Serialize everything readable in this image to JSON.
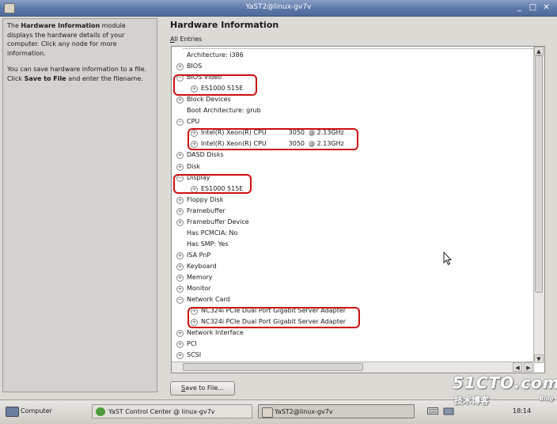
{
  "window": {
    "title": "YaST2@linux-gv7v",
    "buttons": {
      "minimize": "_",
      "maximize": "□",
      "close": "✕"
    }
  },
  "help": {
    "para1_bold": "Hardware Information",
    "para1_rest": " module displays the hardware details of your computer. Click any node for more information.",
    "para1_prefix": "The ",
    "para2_pre": "You can save hardware information to a file. Click ",
    "para2_bold": "Save to File",
    "para2_post": " and enter the filename."
  },
  "main": {
    "heading": "Hardware Information",
    "filter_label_mnemonic": "A",
    "filter_label_rest": "ll Entries"
  },
  "tree": {
    "rows": [
      {
        "text": "Architecture: i386",
        "indent": 1,
        "expander": "none"
      },
      {
        "text": "BIOS",
        "indent": 0,
        "expander": "plus"
      },
      {
        "text": "BIOS Video",
        "indent": 0,
        "expander": "minus"
      },
      {
        "text": "ES1000 515E",
        "indent": 1,
        "expander": "plus"
      },
      {
        "text": "Block Devices",
        "indent": 0,
        "expander": "plus"
      },
      {
        "text": "Boot Architecture: grub",
        "indent": 1,
        "expander": "none"
      },
      {
        "text": "CPU",
        "indent": 0,
        "expander": "minus"
      },
      {
        "text": "Intel(R) Xeon(R) CPU           3050  @ 2.13GHz",
        "indent": 1,
        "expander": "plus"
      },
      {
        "text": "Intel(R) Xeon(R) CPU           3050  @ 2.13GHz",
        "indent": 1,
        "expander": "plus"
      },
      {
        "text": "DASD Disks",
        "indent": 0,
        "expander": "plus"
      },
      {
        "text": "Disk",
        "indent": 0,
        "expander": "plus"
      },
      {
        "text": "Display",
        "indent": 0,
        "expander": "minus"
      },
      {
        "text": "ES1000 515E",
        "indent": 1,
        "expander": "plus"
      },
      {
        "text": "Floppy Disk",
        "indent": 0,
        "expander": "plus"
      },
      {
        "text": "Framebuffer",
        "indent": 0,
        "expander": "plus"
      },
      {
        "text": "Framebuffer Device",
        "indent": 0,
        "expander": "plus"
      },
      {
        "text": "Has PCMCIA: No",
        "indent": 1,
        "expander": "none"
      },
      {
        "text": "Has SMP: Yes",
        "indent": 1,
        "expander": "none"
      },
      {
        "text": "ISA PnP",
        "indent": 0,
        "expander": "plus"
      },
      {
        "text": "Keyboard",
        "indent": 0,
        "expander": "plus"
      },
      {
        "text": "Memory",
        "indent": 0,
        "expander": "plus"
      },
      {
        "text": "Monitor",
        "indent": 0,
        "expander": "plus"
      },
      {
        "text": "Network Card",
        "indent": 0,
        "expander": "minus"
      },
      {
        "text": "NC324i PCIe Dual Port Gigabit Server Adapter",
        "indent": 1,
        "expander": "plus"
      },
      {
        "text": "NC324i PCIe Dual Port Gigabit Server Adapter",
        "indent": 1,
        "expander": "plus"
      },
      {
        "text": "Network Interface",
        "indent": 0,
        "expander": "plus"
      },
      {
        "text": "PCI",
        "indent": 0,
        "expander": "plus"
      },
      {
        "text": "SCSI",
        "indent": 0,
        "expander": "plus"
      }
    ]
  },
  "save_button": {
    "mnemonic": "S",
    "rest": "ave to File..."
  },
  "taskbar": {
    "computer_label": "Computer",
    "task1": "YaST Control Center @ linux-gv7v",
    "task2": "YaST2@linux-gv7v",
    "clock": "18:14"
  },
  "watermark": {
    "site": "51CTO.com",
    "cn": "技术博客",
    "blog": "Blog"
  },
  "colors": {
    "annotation": "#cc1010",
    "titlebar": "#5c78a8"
  }
}
